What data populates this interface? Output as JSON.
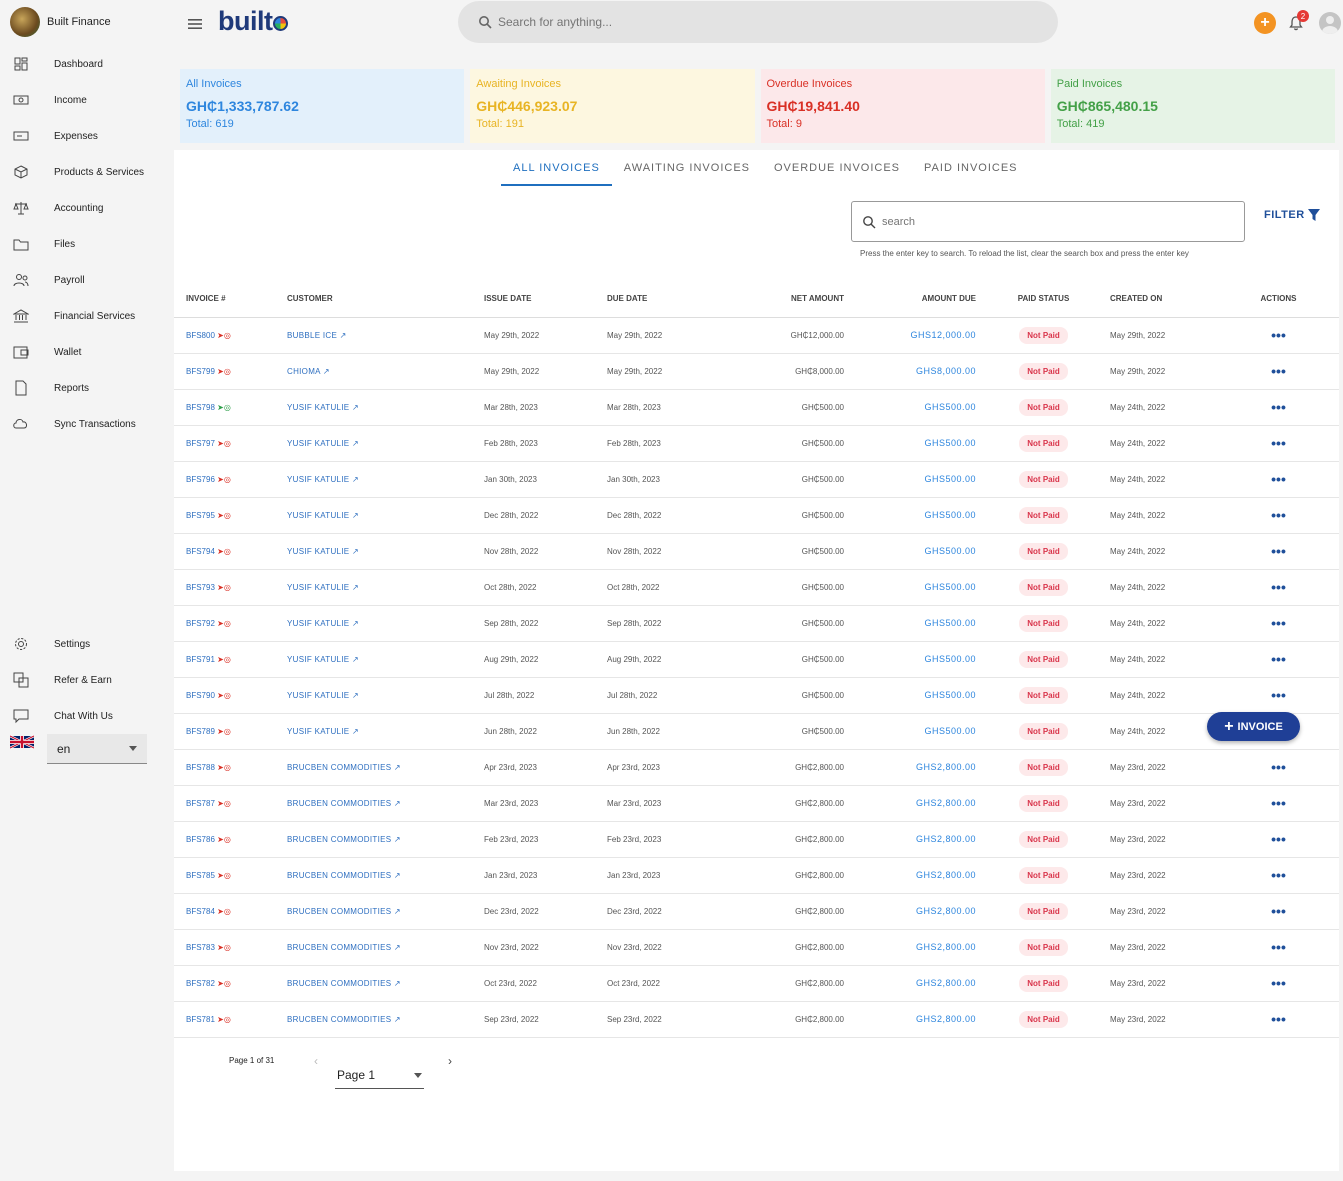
{
  "brand": {
    "name": "Built Finance"
  },
  "logo": {
    "text": "built"
  },
  "sidebar": {
    "items": [
      {
        "label": "Dashboard",
        "icon": "dashboard-icon"
      },
      {
        "label": "Income",
        "icon": "income-icon"
      },
      {
        "label": "Expenses",
        "icon": "expenses-icon"
      },
      {
        "label": "Products & Services",
        "icon": "box-icon"
      },
      {
        "label": "Accounting",
        "icon": "scale-icon"
      },
      {
        "label": "Files",
        "icon": "folder-icon"
      },
      {
        "label": "Payroll",
        "icon": "people-icon"
      },
      {
        "label": "Financial Services",
        "icon": "bank-icon"
      },
      {
        "label": "Wallet",
        "icon": "wallet-icon"
      },
      {
        "label": "Reports",
        "icon": "report-icon"
      },
      {
        "label": "Sync Transactions",
        "icon": "cloud-sync-icon"
      }
    ],
    "bottom_items": [
      {
        "label": "Settings",
        "icon": "gear-icon"
      },
      {
        "label": "Refer & Earn",
        "icon": "refer-icon"
      },
      {
        "label": "Chat With Us",
        "icon": "chat-icon"
      }
    ],
    "language": "en"
  },
  "topbar": {
    "search_placeholder": "Search for anything...",
    "notification_count": "2"
  },
  "summary": {
    "all": {
      "title": "All Invoices",
      "value": "GH₵1,333,787.62",
      "total": "Total: 619"
    },
    "awaiting": {
      "title": "Awaiting Invoices",
      "value": "GH₵446,923.07",
      "total": "Total: 191"
    },
    "overdue": {
      "title": "Overdue Invoices",
      "value": "GH₵19,841.40",
      "total": "Total: 9"
    },
    "paid": {
      "title": "Paid Invoices",
      "value": "GH₵865,480.15",
      "total": "Total: 419"
    }
  },
  "tabs": [
    "ALL INVOICES",
    "AWAITING INVOICES",
    "OVERDUE INVOICES",
    "PAID INVOICES"
  ],
  "list_search": {
    "placeholder": "search",
    "hint": "Press the enter key to search. To reload the list, clear the search box and press the enter key"
  },
  "filter_label": "FILTER",
  "table": {
    "headers": [
      "INVOICE #",
      "CUSTOMER",
      "ISSUE DATE",
      "DUE DATE",
      "NET AMOUNT",
      "AMOUNT DUE",
      "PAID STATUS",
      "CREATED ON",
      "ACTIONS"
    ],
    "rows": [
      {
        "inv": "BFS800",
        "cust": "BUBBLE ICE",
        "issue": "May 29th, 2022",
        "due": "May 29th, 2022",
        "net": "GH₵12,000.00",
        "amt": "GHS12,000.00",
        "status": "Not Paid",
        "created": "May 29th, 2022",
        "viewed": false
      },
      {
        "inv": "BFS799",
        "cust": "CHIOMA",
        "issue": "May 29th, 2022",
        "due": "May 29th, 2022",
        "net": "GH₵8,000.00",
        "amt": "GHS8,000.00",
        "status": "Not Paid",
        "created": "May 29th, 2022",
        "viewed": false
      },
      {
        "inv": "BFS798",
        "cust": "YUSIF KATULIE",
        "issue": "Mar 28th, 2023",
        "due": "Mar 28th, 2023",
        "net": "GH₵500.00",
        "amt": "GHS500.00",
        "status": "Not Paid",
        "created": "May 24th, 2022",
        "viewed": true
      },
      {
        "inv": "BFS797",
        "cust": "YUSIF KATULIE",
        "issue": "Feb 28th, 2023",
        "due": "Feb 28th, 2023",
        "net": "GH₵500.00",
        "amt": "GHS500.00",
        "status": "Not Paid",
        "created": "May 24th, 2022",
        "viewed": false
      },
      {
        "inv": "BFS796",
        "cust": "YUSIF KATULIE",
        "issue": "Jan 30th, 2023",
        "due": "Jan 30th, 2023",
        "net": "GH₵500.00",
        "amt": "GHS500.00",
        "status": "Not Paid",
        "created": "May 24th, 2022",
        "viewed": false
      },
      {
        "inv": "BFS795",
        "cust": "YUSIF KATULIE",
        "issue": "Dec 28th, 2022",
        "due": "Dec 28th, 2022",
        "net": "GH₵500.00",
        "amt": "GHS500.00",
        "status": "Not Paid",
        "created": "May 24th, 2022",
        "viewed": false
      },
      {
        "inv": "BFS794",
        "cust": "YUSIF KATULIE",
        "issue": "Nov 28th, 2022",
        "due": "Nov 28th, 2022",
        "net": "GH₵500.00",
        "amt": "GHS500.00",
        "status": "Not Paid",
        "created": "May 24th, 2022",
        "viewed": false
      },
      {
        "inv": "BFS793",
        "cust": "YUSIF KATULIE",
        "issue": "Oct 28th, 2022",
        "due": "Oct 28th, 2022",
        "net": "GH₵500.00",
        "amt": "GHS500.00",
        "status": "Not Paid",
        "created": "May 24th, 2022",
        "viewed": false
      },
      {
        "inv": "BFS792",
        "cust": "YUSIF KATULIE",
        "issue": "Sep 28th, 2022",
        "due": "Sep 28th, 2022",
        "net": "GH₵500.00",
        "amt": "GHS500.00",
        "status": "Not Paid",
        "created": "May 24th, 2022",
        "viewed": false
      },
      {
        "inv": "BFS791",
        "cust": "YUSIF KATULIE",
        "issue": "Aug 29th, 2022",
        "due": "Aug 29th, 2022",
        "net": "GH₵500.00",
        "amt": "GHS500.00",
        "status": "Not Paid",
        "created": "May 24th, 2022",
        "viewed": false
      },
      {
        "inv": "BFS790",
        "cust": "YUSIF KATULIE",
        "issue": "Jul 28th, 2022",
        "due": "Jul 28th, 2022",
        "net": "GH₵500.00",
        "amt": "GHS500.00",
        "status": "Not Paid",
        "created": "May 24th, 2022",
        "viewed": false
      },
      {
        "inv": "BFS789",
        "cust": "YUSIF KATULIE",
        "issue": "Jun 28th, 2022",
        "due": "Jun 28th, 2022",
        "net": "GH₵500.00",
        "amt": "GHS500.00",
        "status": "Not Paid",
        "created": "May 24th, 2022",
        "viewed": false
      },
      {
        "inv": "BFS788",
        "cust": "BRUCBEN COMMODITIES",
        "issue": "Apr 23rd, 2023",
        "due": "Apr 23rd, 2023",
        "net": "GH₵2,800.00",
        "amt": "GHS2,800.00",
        "status": "Not Paid",
        "created": "May 23rd, 2022",
        "viewed": false
      },
      {
        "inv": "BFS787",
        "cust": "BRUCBEN COMMODITIES",
        "issue": "Mar 23rd, 2023",
        "due": "Mar 23rd, 2023",
        "net": "GH₵2,800.00",
        "amt": "GHS2,800.00",
        "status": "Not Paid",
        "created": "May 23rd, 2022",
        "viewed": false
      },
      {
        "inv": "BFS786",
        "cust": "BRUCBEN COMMODITIES",
        "issue": "Feb 23rd, 2023",
        "due": "Feb 23rd, 2023",
        "net": "GH₵2,800.00",
        "amt": "GHS2,800.00",
        "status": "Not Paid",
        "created": "May 23rd, 2022",
        "viewed": false
      },
      {
        "inv": "BFS785",
        "cust": "BRUCBEN COMMODITIES",
        "issue": "Jan 23rd, 2023",
        "due": "Jan 23rd, 2023",
        "net": "GH₵2,800.00",
        "amt": "GHS2,800.00",
        "status": "Not Paid",
        "created": "May 23rd, 2022",
        "viewed": false
      },
      {
        "inv": "BFS784",
        "cust": "BRUCBEN COMMODITIES",
        "issue": "Dec 23rd, 2022",
        "due": "Dec 23rd, 2022",
        "net": "GH₵2,800.00",
        "amt": "GHS2,800.00",
        "status": "Not Paid",
        "created": "May 23rd, 2022",
        "viewed": false
      },
      {
        "inv": "BFS783",
        "cust": "BRUCBEN COMMODITIES",
        "issue": "Nov 23rd, 2022",
        "due": "Nov 23rd, 2022",
        "net": "GH₵2,800.00",
        "amt": "GHS2,800.00",
        "status": "Not Paid",
        "created": "May 23rd, 2022",
        "viewed": false
      },
      {
        "inv": "BFS782",
        "cust": "BRUCBEN COMMODITIES",
        "issue": "Oct 23rd, 2022",
        "due": "Oct 23rd, 2022",
        "net": "GH₵2,800.00",
        "amt": "GHS2,800.00",
        "status": "Not Paid",
        "created": "May 23rd, 2022",
        "viewed": false
      },
      {
        "inv": "BFS781",
        "cust": "BRUCBEN COMMODITIES",
        "issue": "Sep 23rd, 2022",
        "due": "Sep 23rd, 2022",
        "net": "GH₵2,800.00",
        "amt": "GHS2,800.00",
        "status": "Not Paid",
        "created": "May 23rd, 2022",
        "viewed": false
      }
    ]
  },
  "fab_label": "INVOICE",
  "pagination": {
    "text": "Page 1 of 31",
    "selected": "Page 1"
  },
  "colors": {
    "accent": "#1f6fbf",
    "fab": "#1f3f96",
    "orange": "#f39322",
    "not_paid_bg": "#fde9ea",
    "not_paid_text": "#d9354b"
  }
}
